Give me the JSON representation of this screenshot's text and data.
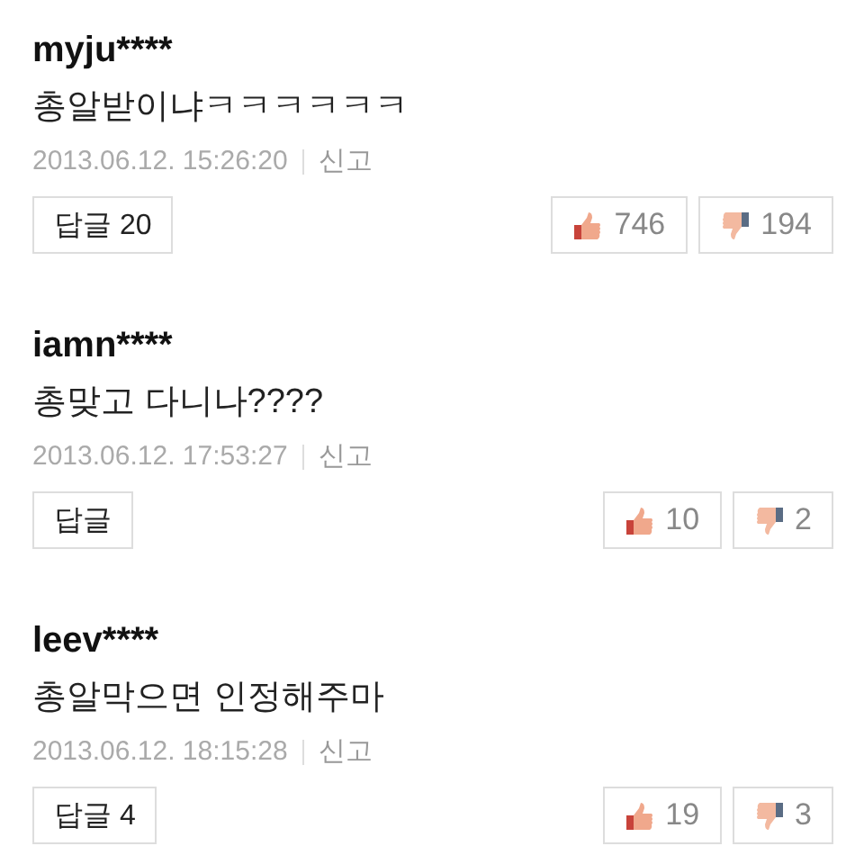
{
  "comments": [
    {
      "author": "myju****",
      "text": "총알받이냐ㅋㅋㅋㅋㅋㅋ",
      "date": "2013.06.12. 15:26:20",
      "report": "신고",
      "reply": "답글 20",
      "likes": "746",
      "dislikes": "194"
    },
    {
      "author": "iamn****",
      "text": "총맞고 다니나????",
      "date": "2013.06.12. 17:53:27",
      "report": "신고",
      "reply": "답글",
      "likes": "10",
      "dislikes": "2"
    },
    {
      "author": "leev****",
      "text": "총알막으면 인정해주마",
      "date": "2013.06.12. 18:15:28",
      "report": "신고",
      "reply": "답글 4",
      "likes": "19",
      "dislikes": "3"
    }
  ]
}
